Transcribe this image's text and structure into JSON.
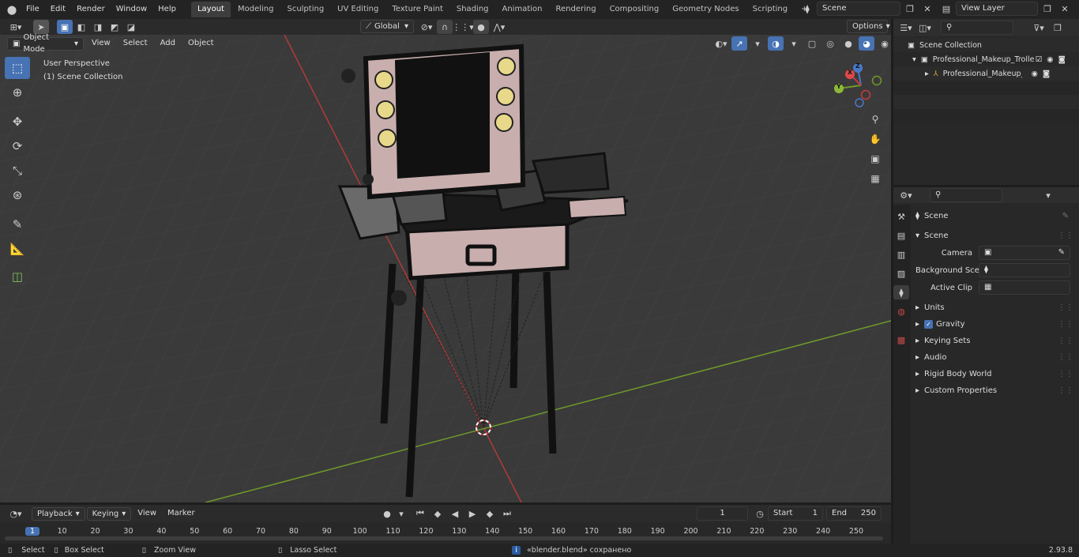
{
  "menu": {
    "file": "File",
    "edit": "Edit",
    "render": "Render",
    "window": "Window",
    "help": "Help"
  },
  "workspaces": [
    "Layout",
    "Modeling",
    "Sculpting",
    "UV Editing",
    "Texture Paint",
    "Shading",
    "Animation",
    "Rendering",
    "Compositing",
    "Geometry Nodes",
    "Scripting"
  ],
  "top_right": {
    "scene": "Scene",
    "view_layer": "View Layer"
  },
  "viewport_header": {
    "mode": "Object Mode",
    "view": "View",
    "select": "Select",
    "add": "Add",
    "object": "Object",
    "transform": "Global",
    "options": "Options"
  },
  "viewport": {
    "perspective": "User Perspective",
    "collection": "(1) Scene Collection"
  },
  "gizmo": {
    "x": "X",
    "y": "Y",
    "z": "Z"
  },
  "outliner": {
    "scene_collection": "Scene Collection",
    "items": [
      {
        "label": "Professional_Makeup_Trolley_"
      },
      {
        "label": "Professional_Makeup_Tro"
      }
    ]
  },
  "properties": {
    "header": "Scene",
    "section": "Scene",
    "fields": [
      {
        "label": "Camera"
      },
      {
        "label": "Background Scene"
      },
      {
        "label": "Active Clip"
      }
    ],
    "panels": [
      "Units",
      "Gravity",
      "Keying Sets",
      "Audio",
      "Rigid Body World",
      "Custom Properties"
    ]
  },
  "timeline": {
    "playback": "Playback",
    "keying": "Keying",
    "view": "View",
    "marker": "Marker",
    "current_frame": "1",
    "start_label": "Start",
    "start": "1",
    "end_label": "End",
    "end": "250",
    "ticks": [
      "1",
      "10",
      "20",
      "30",
      "40",
      "50",
      "60",
      "70",
      "80",
      "90",
      "100",
      "110",
      "120",
      "130",
      "140",
      "150",
      "160",
      "170",
      "180",
      "190",
      "200",
      "210",
      "220",
      "230",
      "240",
      "250"
    ]
  },
  "status": {
    "select": "Select",
    "box_select": "Box Select",
    "zoom_view": "Zoom View",
    "lasso_select": "Lasso Select",
    "message": "«blender.blend» сохранено",
    "version": "2.93.8"
  },
  "colors": {
    "accent": "#4772b3",
    "x_axis": "#c43b3b",
    "y_axis": "#6f9a29",
    "viewport_bg": "#3a3a3a"
  }
}
